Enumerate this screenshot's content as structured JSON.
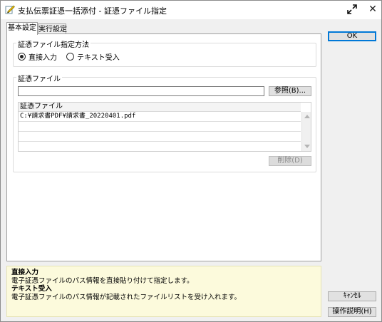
{
  "window": {
    "title": "支払伝票証憑一括添付 - 証憑ファイル指定",
    "close_glyph": "✕"
  },
  "tabs": [
    {
      "label": "基本設定",
      "active": true
    },
    {
      "label": "実行設定",
      "active": false
    }
  ],
  "method_group": {
    "title": "証憑ファイル指定方法",
    "options": [
      {
        "label": "直接入力",
        "checked": true
      },
      {
        "label": "テキスト受入",
        "checked": false
      }
    ]
  },
  "file_group": {
    "title": "証憑ファイル",
    "path_value": "",
    "browse_label": "参照(B)...",
    "table": {
      "header": "証憑ファイル",
      "rows": [
        "C:¥請求書PDF¥請求書_20220401.pdf",
        "",
        "",
        "",
        ""
      ]
    },
    "delete_label": "削除(D)"
  },
  "help": {
    "items": [
      {
        "head": "直接入力",
        "body": "電子証憑ファイルのパス情報を直接貼り付けて指定します。"
      },
      {
        "head": "テキスト受入",
        "body": "電子証憑ファイルのパス情報が記載されたファイルリストを受け入れます。"
      }
    ]
  },
  "buttons": {
    "ok": "OK",
    "cancel": "ｷｬﾝｾﾙ",
    "help": "操作説明(H)"
  }
}
